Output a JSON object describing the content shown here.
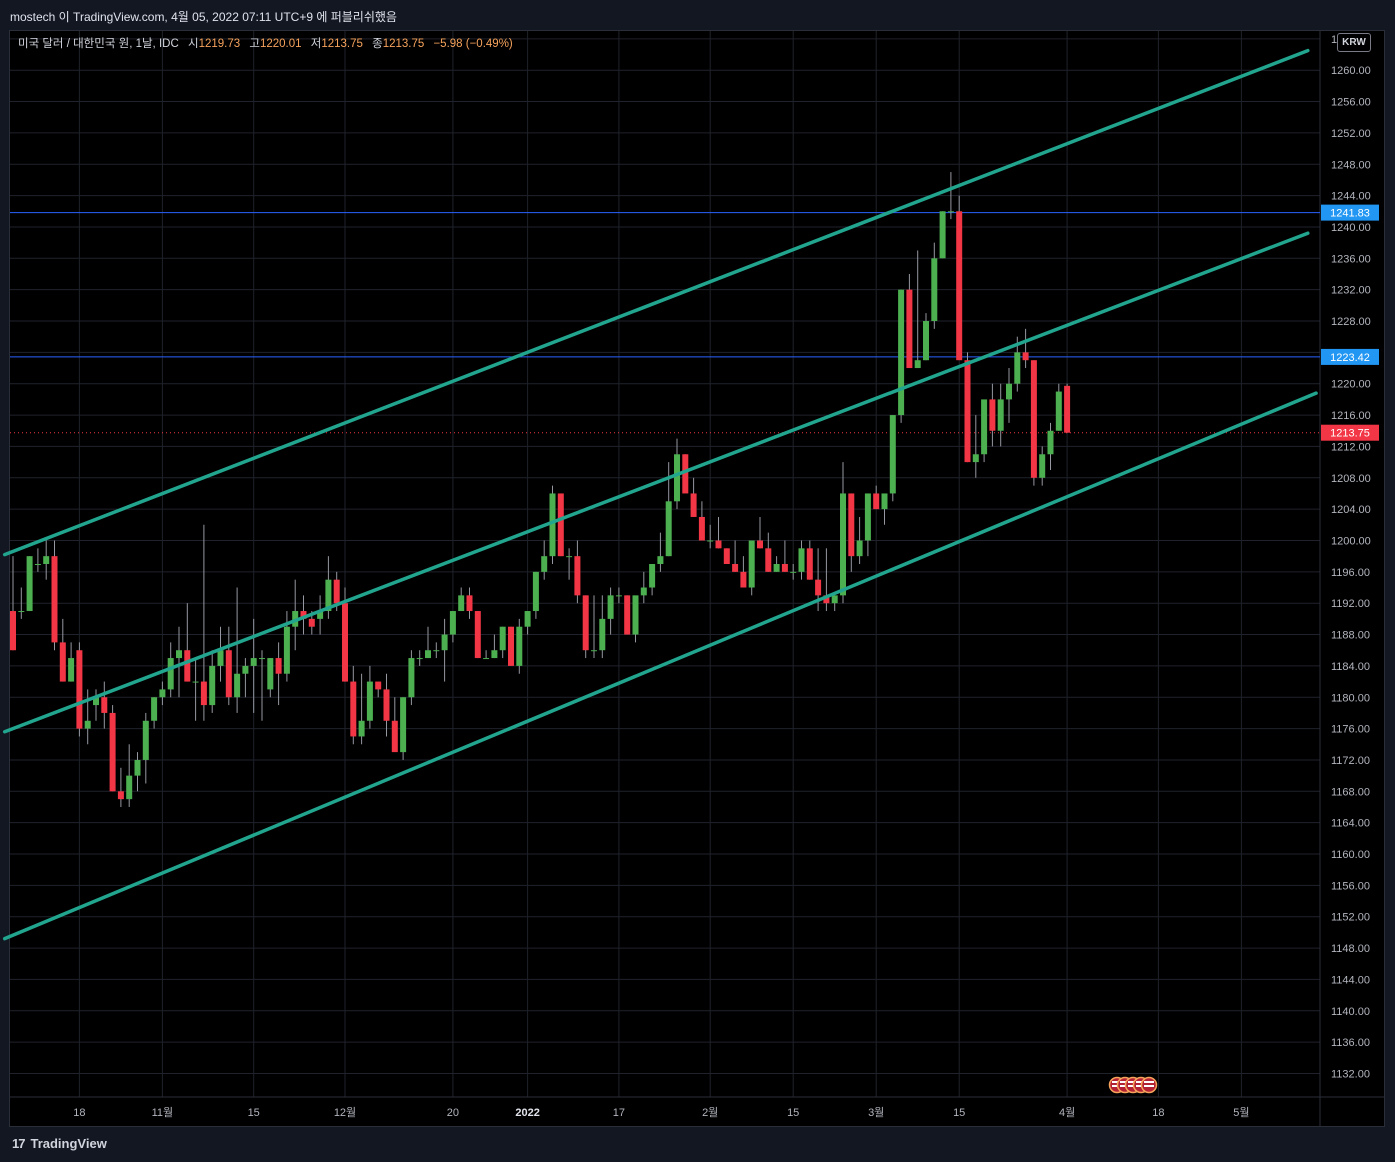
{
  "header": {
    "publisher_line": "mostech 이 TradingView.com, 4월 05, 2022 07:11 UTC+9 에 퍼블리쉬했음"
  },
  "legend": {
    "symbol": "미국 달러 / 대한민국 원, 1날, IDC",
    "open_label": "시",
    "open": "1219.73",
    "high_label": "고",
    "high": "1220.01",
    "low_label": "저",
    "low": "1213.75",
    "close_label": "종",
    "close": "1213.75",
    "change": "−5.98 (−0.49%)"
  },
  "currency_button": "KRW",
  "brand": {
    "logo": "17",
    "name": "TradingView"
  },
  "colors": {
    "up": "#26a69a",
    "candle_up": "#4caf50",
    "candle_down": "#f23645",
    "channel": "#22a58e",
    "hline": "#2962ff",
    "price_label_blue": "#2196f3",
    "last_price": "#f23645"
  },
  "chart_data": {
    "type": "candlestick",
    "title": "미국 달러 / 대한민국 원, 1날, IDC",
    "ylim": [
      1129,
      1265
    ],
    "y_ticks": [
      1132,
      1136,
      1140,
      1144,
      1148,
      1152,
      1156,
      1160,
      1164,
      1168,
      1172,
      1176,
      1180,
      1184,
      1188,
      1192,
      1196,
      1200,
      1204,
      1208,
      1212,
      1216,
      1220,
      1224,
      1228,
      1232,
      1236,
      1240,
      1244,
      1248,
      1252,
      1256,
      1260,
      1264
    ],
    "x_ticks": [
      {
        "label": "18",
        "i": 8
      },
      {
        "label": "11월",
        "i": 18
      },
      {
        "label": "15",
        "i": 29
      },
      {
        "label": "12월",
        "i": 40
      },
      {
        "label": "20",
        "i": 53
      },
      {
        "label": "2022",
        "i": 62
      },
      {
        "label": "17",
        "i": 73
      },
      {
        "label": "2월",
        "i": 84
      },
      {
        "label": "15",
        "i": 94
      },
      {
        "label": "3월",
        "i": 104
      },
      {
        "label": "15",
        "i": 114
      },
      {
        "label": "4월",
        "i": 127
      },
      {
        "label": "18",
        "i": 138
      },
      {
        "label": "5월",
        "i": 148
      }
    ],
    "candles": [
      [
        1191,
        1198,
        1186,
        1186
      ],
      [
        1191,
        1194,
        1190,
        1191
      ],
      [
        1191,
        1198,
        1191,
        1198
      ],
      [
        1197,
        1199,
        1196,
        1197
      ],
      [
        1197,
        1200,
        1195,
        1198
      ],
      [
        1198,
        1200,
        1186,
        1187
      ],
      [
        1187,
        1190,
        1182,
        1182
      ],
      [
        1182,
        1187,
        1182,
        1185
      ],
      [
        1186,
        1187,
        1175,
        1176
      ],
      [
        1176,
        1181,
        1174,
        1177
      ],
      [
        1179,
        1181,
        1177,
        1180
      ],
      [
        1180,
        1182,
        1176,
        1178
      ],
      [
        1178,
        1179,
        1168,
        1168
      ],
      [
        1168,
        1171,
        1166,
        1167
      ],
      [
        1167,
        1174,
        1166,
        1170
      ],
      [
        1170,
        1173,
        1168,
        1172
      ],
      [
        1172,
        1178,
        1169,
        1177
      ],
      [
        1177,
        1180,
        1176,
        1180
      ],
      [
        1180,
        1182,
        1179,
        1181
      ],
      [
        1181,
        1187,
        1180,
        1185
      ],
      [
        1185,
        1189,
        1180,
        1186
      ],
      [
        1186,
        1192,
        1182,
        1182
      ],
      [
        1182,
        1185,
        1177,
        1182
      ],
      [
        1182,
        1202,
        1177,
        1179
      ],
      [
        1179,
        1186,
        1178,
        1184
      ],
      [
        1184,
        1189,
        1182,
        1186
      ],
      [
        1186,
        1189,
        1179,
        1180
      ],
      [
        1180,
        1194,
        1178,
        1183
      ],
      [
        1183,
        1185,
        1180,
        1184
      ],
      [
        1184,
        1190,
        1178,
        1185
      ],
      [
        1185,
        1186,
        1177,
        1185
      ],
      [
        1181,
        1185,
        1180,
        1185
      ],
      [
        1185,
        1187,
        1179,
        1183
      ],
      [
        1183,
        1191,
        1182,
        1189
      ],
      [
        1189,
        1195,
        1186,
        1191
      ],
      [
        1191,
        1193,
        1188,
        1190
      ],
      [
        1190,
        1191,
        1188,
        1189
      ],
      [
        1190,
        1193,
        1188,
        1191
      ],
      [
        1191,
        1198,
        1190,
        1195
      ],
      [
        1195,
        1196,
        1191,
        1192
      ],
      [
        1192,
        1194,
        1182,
        1182
      ],
      [
        1182,
        1184,
        1174,
        1175
      ],
      [
        1175,
        1183,
        1174,
        1177
      ],
      [
        1177,
        1184,
        1176,
        1182
      ],
      [
        1182,
        1182,
        1180,
        1181
      ],
      [
        1181,
        1183,
        1175,
        1177
      ],
      [
        1177,
        1180,
        1174,
        1173
      ],
      [
        1173,
        1180,
        1172,
        1180
      ],
      [
        1180,
        1186,
        1179,
        1185
      ],
      [
        1185,
        1186,
        1184,
        1185
      ],
      [
        1185,
        1189,
        1185,
        1186
      ],
      [
        1186,
        1187,
        1185,
        1186
      ],
      [
        1186,
        1190,
        1182,
        1188
      ],
      [
        1188,
        1191,
        1187,
        1191
      ],
      [
        1191,
        1194,
        1191,
        1193
      ],
      [
        1193,
        1194,
        1190,
        1191
      ],
      [
        1191,
        1191,
        1185,
        1185
      ],
      [
        1185,
        1186,
        1185,
        1185
      ],
      [
        1185,
        1188,
        1185,
        1186
      ],
      [
        1186,
        1189,
        1185,
        1189
      ],
      [
        1189,
        1189,
        1184,
        1184
      ],
      [
        1184,
        1190,
        1183,
        1189
      ],
      [
        1189,
        1191,
        1188,
        1191
      ],
      [
        1191,
        1196,
        1190,
        1196
      ],
      [
        1196,
        1200,
        1195,
        1198
      ],
      [
        1198,
        1207,
        1197,
        1206
      ],
      [
        1206,
        1206,
        1198,
        1198
      ],
      [
        1198,
        1199,
        1195,
        1198
      ],
      [
        1198,
        1200,
        1192,
        1193
      ],
      [
        1193,
        1193,
        1185,
        1186
      ],
      [
        1186,
        1193,
        1185,
        1186
      ],
      [
        1186,
        1193,
        1185,
        1190
      ],
      [
        1190,
        1194,
        1188,
        1193
      ],
      [
        1193,
        1194,
        1192,
        1193
      ],
      [
        1193,
        1193,
        1188,
        1188
      ],
      [
        1188,
        1192,
        1187,
        1193
      ],
      [
        1193,
        1196,
        1192,
        1194
      ],
      [
        1194,
        1197,
        1193,
        1197
      ],
      [
        1197,
        1201,
        1196,
        1198
      ],
      [
        1198,
        1210,
        1198,
        1205
      ],
      [
        1205,
        1213,
        1204,
        1211
      ],
      [
        1211,
        1211,
        1207,
        1206
      ],
      [
        1206,
        1208,
        1203,
        1203
      ],
      [
        1203,
        1205,
        1200,
        1200
      ],
      [
        1200,
        1202,
        1199,
        1200
      ],
      [
        1200,
        1203,
        1199,
        1199
      ],
      [
        1199,
        1199,
        1197,
        1197
      ],
      [
        1197,
        1200,
        1196,
        1196
      ],
      [
        1196,
        1198,
        1194,
        1194
      ],
      [
        1194,
        1198,
        1193,
        1200
      ],
      [
        1200,
        1203,
        1199,
        1199
      ],
      [
        1199,
        1201,
        1196,
        1196
      ],
      [
        1196,
        1198,
        1196,
        1197
      ],
      [
        1197,
        1200,
        1196,
        1196
      ],
      [
        1196,
        1197,
        1195,
        1196
      ],
      [
        1196,
        1200,
        1195,
        1199
      ],
      [
        1199,
        1200,
        1195,
        1195
      ],
      [
        1195,
        1199,
        1191,
        1193
      ],
      [
        1193,
        1199,
        1191,
        1192
      ],
      [
        1192,
        1193,
        1191,
        1193
      ],
      [
        1193,
        1210,
        1192,
        1206
      ],
      [
        1206,
        1206,
        1196,
        1198
      ],
      [
        1198,
        1203,
        1197,
        1200
      ],
      [
        1200,
        1206,
        1198,
        1206
      ],
      [
        1206,
        1207,
        1204,
        1204
      ],
      [
        1204,
        1205,
        1202,
        1206
      ],
      [
        1206,
        1216,
        1205,
        1216
      ],
      [
        1216,
        1232,
        1215,
        1232
      ],
      [
        1232,
        1234,
        1222,
        1222
      ],
      [
        1222,
        1237,
        1222,
        1223
      ],
      [
        1223,
        1229,
        1223,
        1228
      ],
      [
        1228,
        1238,
        1227,
        1236
      ],
      [
        1236,
        1242,
        1236,
        1242
      ],
      [
        1242,
        1247,
        1241,
        1242
      ],
      [
        1242,
        1244,
        1224,
        1223
      ],
      [
        1223,
        1224,
        1210,
        1210
      ],
      [
        1210,
        1216,
        1208,
        1211
      ],
      [
        1211,
        1217,
        1210,
        1218
      ],
      [
        1218,
        1220,
        1212,
        1214
      ],
      [
        1214,
        1220,
        1212,
        1218
      ],
      [
        1218,
        1222,
        1215,
        1220
      ],
      [
        1220,
        1226,
        1219,
        1224
      ],
      [
        1224,
        1227,
        1222,
        1223
      ],
      [
        1223,
        1223,
        1207,
        1208
      ],
      [
        1208,
        1212,
        1207,
        1211
      ],
      [
        1211,
        1215,
        1209,
        1214
      ],
      [
        1214,
        1220,
        1214,
        1219
      ],
      [
        1219.73,
        1220.01,
        1213.75,
        1213.75
      ]
    ],
    "channel_lines": [
      {
        "name": "upper",
        "from": {
          "i": -1,
          "y": 1198.2
        },
        "to": {
          "i": 156,
          "y": 1262.5
        }
      },
      {
        "name": "middle",
        "from": {
          "i": -1,
          "y": 1175.6
        },
        "to": {
          "i": 156,
          "y": 1239.2
        }
      },
      {
        "name": "lower",
        "from": {
          "i": -1,
          "y": 1149.2
        },
        "to": {
          "i": 157,
          "y": 1218.8
        }
      }
    ],
    "horizontal_lines": [
      {
        "value": 1241.83,
        "label": "1241.83"
      },
      {
        "value": 1223.42,
        "label": "1223.42"
      }
    ],
    "last_price": {
      "value": 1213.75,
      "label": "1213.75"
    },
    "events_label": "US"
  }
}
